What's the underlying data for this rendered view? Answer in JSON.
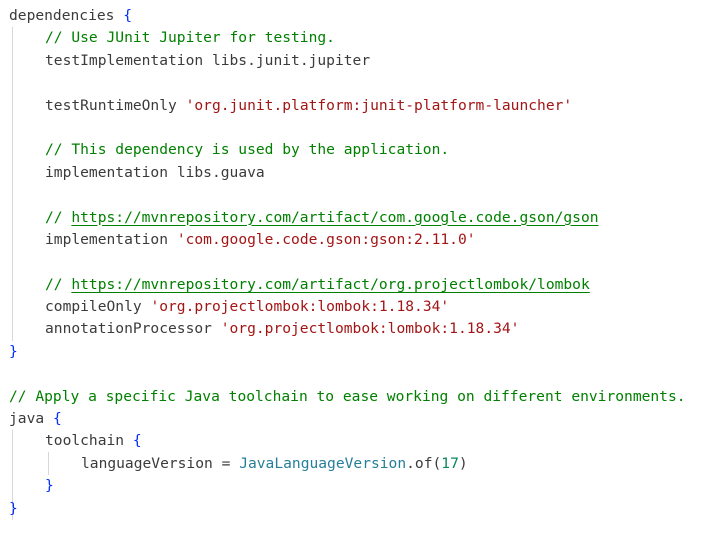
{
  "code": {
    "l1": {
      "kw": "dependencies",
      "brace": "{"
    },
    "l2": {
      "comment": "// Use JUnit Jupiter for testing."
    },
    "l3": {
      "kw": "testImplementation",
      "arg": "libs.junit.jupiter"
    },
    "l5": {
      "kw": "testRuntimeOnly",
      "str": "'org.junit.platform:junit-platform-launcher'"
    },
    "l7": {
      "comment": "// This dependency is used by the application."
    },
    "l8": {
      "kw": "implementation",
      "arg": "libs.guava"
    },
    "l10": {
      "prefix": "// ",
      "link": "https://mvnrepository.com/artifact/com.google.code.gson/gson"
    },
    "l11": {
      "kw": "implementation",
      "str": "'com.google.code.gson:gson:2.11.0'"
    },
    "l13": {
      "prefix": "// ",
      "link": "https://mvnrepository.com/artifact/org.projectlombok/lombok"
    },
    "l14": {
      "kw": "compileOnly",
      "str": "'org.projectlombok:lombok:1.18.34'"
    },
    "l15": {
      "kw": "annotationProcessor",
      "str": "'org.projectlombok:lombok:1.18.34'"
    },
    "l16": {
      "brace": "}"
    },
    "l18": {
      "comment": "// Apply a specific Java toolchain to ease working on different environments."
    },
    "l19": {
      "kw": "java",
      "brace": "{"
    },
    "l20": {
      "kw": "toolchain",
      "brace": "{"
    },
    "l21": {
      "kw": "languageVersion",
      "op": "=",
      "type": "JavaLanguageVersion",
      "call": ".of(",
      "num": "17",
      "close": ")"
    },
    "l22": {
      "brace": "}"
    },
    "l23": {
      "brace": "}"
    }
  },
  "colors": {
    "comment": "#008000",
    "string": "#a31515",
    "brace": "#0431fa",
    "type": "#267f99",
    "number": "#098658",
    "text": "#3b3b3b"
  }
}
